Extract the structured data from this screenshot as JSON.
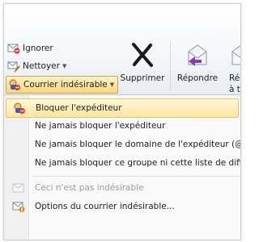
{
  "ribbon": {
    "ignore_label": "Ignorer",
    "clean_label": "Nettoyer",
    "junk_label": "Courrier indésirable",
    "delete_label": "Supprimer",
    "reply_label": "Répondre",
    "reply_all_label_line1": "Répo",
    "reply_all_label_line2": "à t"
  },
  "junk_menu": {
    "items": [
      {
        "label": "Bloquer l'expéditeur",
        "enabled": true,
        "highlighted": true,
        "icon": "block-sender-icon"
      },
      {
        "label": "Ne jamais bloquer l'expéditeur",
        "enabled": true
      },
      {
        "label": "Ne jamais bloquer le domaine de l'expéditeur (@",
        "enabled": true
      },
      {
        "label": "Ne jamais bloquer ce groupe ni cette liste de diff",
        "enabled": true
      },
      {
        "label": "Ceci n'est pas indésirable",
        "enabled": false,
        "icon": "not-junk-icon"
      },
      {
        "label": "Options du courrier indésirable...",
        "enabled": true,
        "icon": "junk-options-icon"
      }
    ]
  },
  "colors": {
    "highlight_bg": "#ffe6a0",
    "highlight_border": "#e6c46a",
    "disabled_text": "#9a9a9a",
    "envelope_arrow": "#8b3bb3"
  }
}
